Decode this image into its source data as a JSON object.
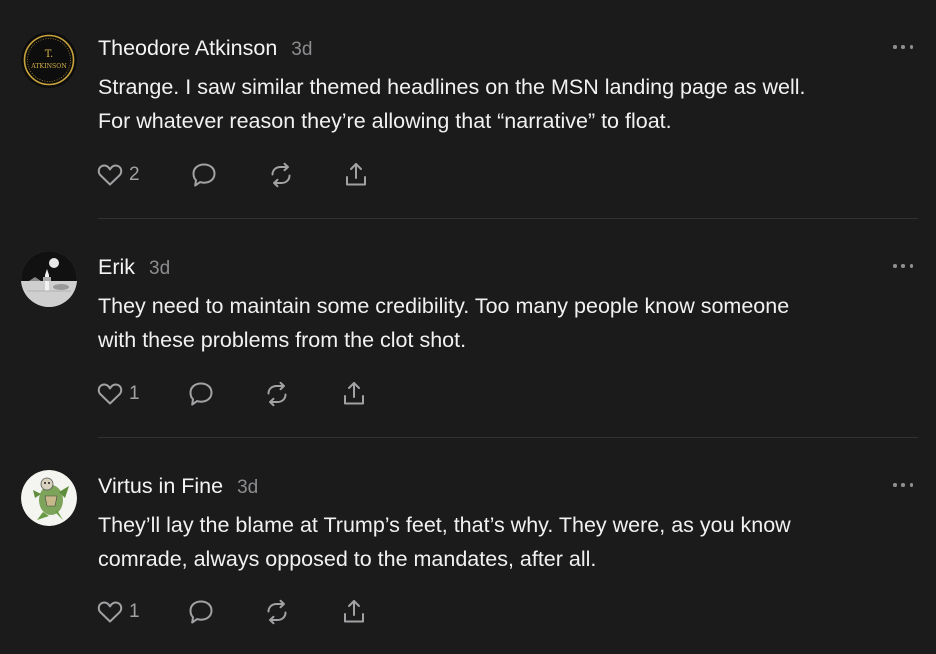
{
  "comments": [
    {
      "author": "Theodore Atkinson",
      "time": "3d",
      "avatar_text": {
        "top": "T.",
        "bottom": "ATKINSON"
      },
      "text_lines": [
        "Strange. I saw similar themed headlines on the MSN landing page as well.",
        "For whatever reason they’re allowing that “narrative” to float."
      ],
      "likes": "2"
    },
    {
      "author": "Erik",
      "time": "3d",
      "text_lines": [
        "They need to maintain some credibility. Too many people know someone",
        "with these problems from the clot shot."
      ],
      "likes": "1"
    },
    {
      "author": "Virtus in Fine",
      "time": "3d",
      "text_lines": [
        "They’ll lay the blame at Trump’s feet, that’s why. They were, as you know",
        "comrade, always opposed to the mandates, after all."
      ],
      "likes": "1"
    }
  ],
  "icons": {
    "like": "heart-icon",
    "reply": "speech-bubble-icon",
    "restack": "restack-icon",
    "share": "share-upload-icon",
    "more": "more-horizontal-icon"
  },
  "colors": {
    "background": "#1b1b1c",
    "text": "#f1f1f1",
    "muted": "#8d8d90",
    "icon": "#a2a2a5",
    "divider": "#323234"
  }
}
